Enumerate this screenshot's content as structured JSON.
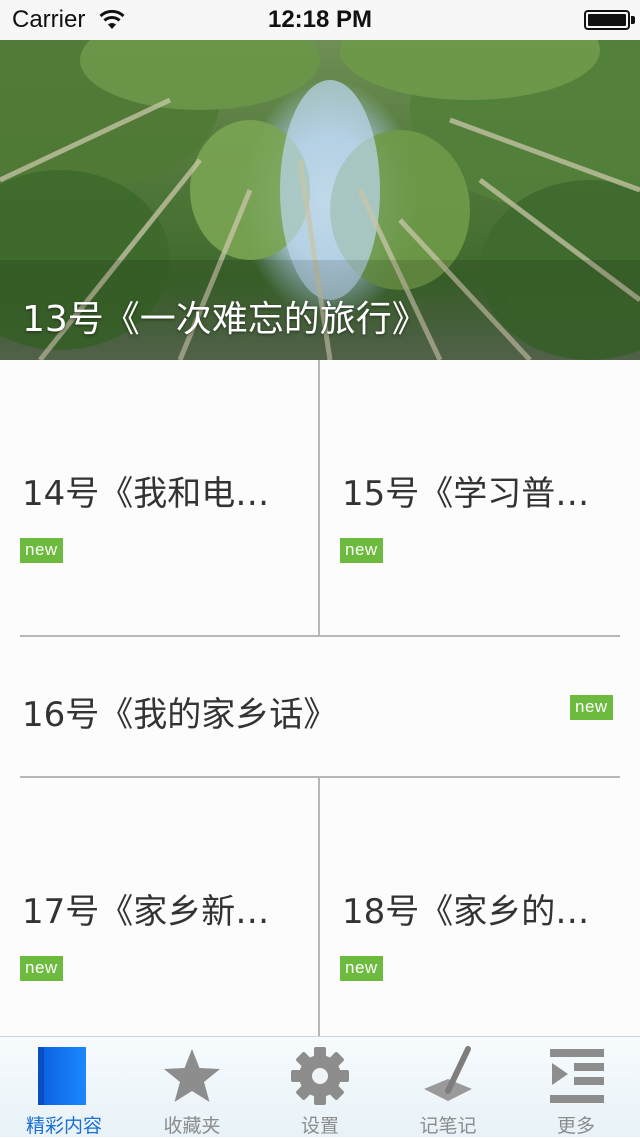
{
  "status_bar": {
    "carrier": "Carrier",
    "time": "12:18 PM"
  },
  "hero": {
    "title": "13号《一次难忘的旅行》"
  },
  "grid": {
    "cell_14": {
      "title": "14号《我和电…",
      "badge": "new"
    },
    "cell_15": {
      "title": "15号《学习普…",
      "badge": "new"
    },
    "cell_16": {
      "title": "16号《我的家乡话》",
      "badge": "new"
    },
    "cell_17": {
      "title": "17号《家乡新…",
      "badge": "new"
    },
    "cell_18": {
      "title": "18号《家乡的…",
      "badge": "new"
    }
  },
  "tab_bar": {
    "tabs": [
      {
        "label": "精彩内容",
        "icon": "book-icon",
        "active": true
      },
      {
        "label": "收藏夹",
        "icon": "star-icon",
        "active": false
      },
      {
        "label": "设置",
        "icon": "gear-icon",
        "active": false
      },
      {
        "label": "记笔记",
        "icon": "pen-icon",
        "active": false
      },
      {
        "label": "更多",
        "icon": "more-list-icon",
        "active": false
      }
    ]
  },
  "colors": {
    "badge": "#6cba3e",
    "active_tab": "#1a6fd6",
    "inactive_tab": "#8c8c8c"
  }
}
